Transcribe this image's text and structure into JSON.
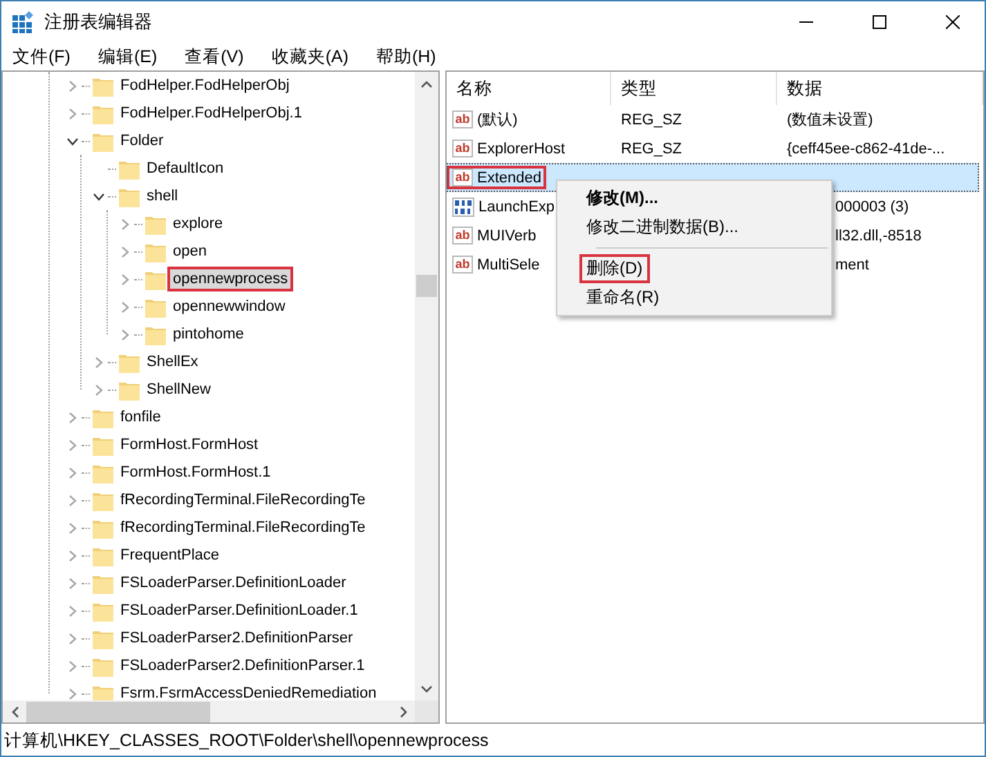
{
  "window": {
    "title": "注册表编辑器"
  },
  "menu": [
    "文件(F)",
    "编辑(E)",
    "查看(V)",
    "收藏夹(A)",
    "帮助(H)"
  ],
  "tree": [
    {
      "label": "FodHelper.FodHelperObj",
      "expanded": false,
      "selected": false,
      "highlighted": false
    },
    {
      "label": "FodHelper.FodHelperObj.1",
      "expanded": false,
      "selected": false,
      "highlighted": false
    },
    {
      "label": "Folder",
      "expanded": true,
      "selected": false,
      "highlighted": false,
      "children": [
        {
          "label": "DefaultIcon",
          "selected": false,
          "highlighted": false
        },
        {
          "label": "shell",
          "expanded": true,
          "selected": false,
          "highlighted": false,
          "children": [
            {
              "label": "explore",
              "expanded": false,
              "selected": false,
              "highlighted": false
            },
            {
              "label": "open",
              "expanded": false,
              "selected": false,
              "highlighted": false
            },
            {
              "label": "opennewprocess",
              "expanded": false,
              "selected": true,
              "highlighted": true
            },
            {
              "label": "opennewwindow",
              "expanded": false,
              "selected": false,
              "highlighted": false
            },
            {
              "label": "pintohome",
              "expanded": false,
              "selected": false,
              "highlighted": false
            }
          ]
        },
        {
          "label": "ShellEx",
          "expanded": false,
          "selected": false,
          "highlighted": false
        },
        {
          "label": "ShellNew",
          "expanded": false,
          "selected": false,
          "highlighted": false
        }
      ]
    },
    {
      "label": "fonfile",
      "expanded": false,
      "selected": false,
      "highlighted": false
    },
    {
      "label": "FormHost.FormHost",
      "expanded": false,
      "selected": false,
      "highlighted": false
    },
    {
      "label": "FormHost.FormHost.1",
      "expanded": false,
      "selected": false,
      "highlighted": false
    },
    {
      "label": "fRecordingTerminal.FileRecordingTe",
      "expanded": false,
      "selected": false,
      "highlighted": false
    },
    {
      "label": "fRecordingTerminal.FileRecordingTe",
      "expanded": false,
      "selected": false,
      "highlighted": false
    },
    {
      "label": "FrequentPlace",
      "expanded": false,
      "selected": false,
      "highlighted": false
    },
    {
      "label": "FSLoaderParser.DefinitionLoader",
      "expanded": false,
      "selected": false,
      "highlighted": false
    },
    {
      "label": "FSLoaderParser.DefinitionLoader.1",
      "expanded": false,
      "selected": false,
      "highlighted": false
    },
    {
      "label": "FSLoaderParser2.DefinitionParser",
      "expanded": false,
      "selected": false,
      "highlighted": false
    },
    {
      "label": "FSLoaderParser2.DefinitionParser.1",
      "expanded": false,
      "selected": false,
      "highlighted": false
    },
    {
      "label": "Fsrm.FsrmAccessDeniedRemediation",
      "expanded": false,
      "selected": false,
      "highlighted": false
    }
  ],
  "values": {
    "columns": [
      "名称",
      "类型",
      "数据"
    ],
    "rows": [
      {
        "kind": "string",
        "icon_label": "ab",
        "name": "(默认)",
        "type": "REG_SZ",
        "data": "(数值未设置)",
        "selected": false,
        "highlighted": false
      },
      {
        "kind": "string",
        "icon_label": "ab",
        "name": "ExplorerHost",
        "type": "REG_SZ",
        "data": "{ceff45ee-c862-41de-...",
        "selected": false,
        "highlighted": false
      },
      {
        "kind": "string",
        "icon_label": "ab",
        "name": "Extended",
        "selected": true,
        "highlighted": true
      },
      {
        "kind": "binary",
        "name": "LaunchExp",
        "data": "000003 (3)",
        "selected": false,
        "highlighted": false
      },
      {
        "kind": "string",
        "icon_label": "ab",
        "name": "MUIVerb",
        "data": "ll32.dll,-8518",
        "selected": false,
        "highlighted": false
      },
      {
        "kind": "string",
        "icon_label": "ab",
        "name": "MultiSele",
        "data": "ment",
        "selected": false,
        "highlighted": false
      }
    ]
  },
  "context_menu": [
    {
      "kind": "item",
      "label": "修改(M)...",
      "bold": true,
      "highlighted": false
    },
    {
      "kind": "item",
      "label": "修改二进制数据(B)...",
      "bold": false,
      "highlighted": false
    },
    {
      "kind": "separator"
    },
    {
      "kind": "item",
      "label": "删除(D)",
      "bold": false,
      "highlighted": true
    },
    {
      "kind": "item",
      "label": "重命名(R)",
      "bold": false,
      "highlighted": false
    }
  ],
  "status_bar": "计算机\\HKEY_CLASSES_ROOT\\Folder\\shell\\opennewprocess"
}
